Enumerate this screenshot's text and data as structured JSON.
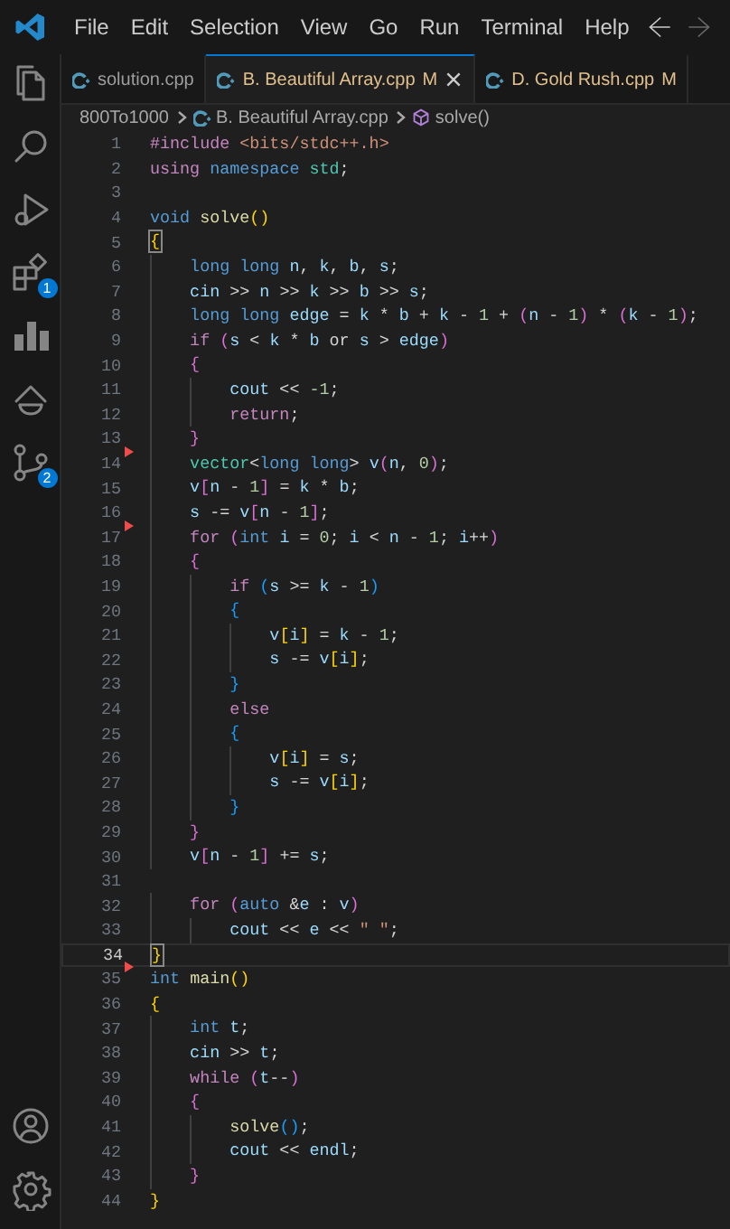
{
  "menu": [
    "File",
    "Edit",
    "Selection",
    "View",
    "Go",
    "Run",
    "Terminal",
    "Help"
  ],
  "activity_bar": [
    {
      "kind": "explorer"
    },
    {
      "kind": "search"
    },
    {
      "kind": "debug"
    },
    {
      "kind": "extensions",
      "badge": "1"
    },
    {
      "kind": "chart"
    },
    {
      "kind": "branch"
    },
    {
      "kind": "git",
      "badge": "2"
    }
  ],
  "activity_bar_bottom": [
    {
      "kind": "account"
    },
    {
      "kind": "settings"
    }
  ],
  "tabs": [
    {
      "label": "solution.cpp",
      "selected": false
    },
    {
      "label": "B. Beautiful Array.cpp",
      "status": "M",
      "selected": true
    },
    {
      "label": "D. Gold Rush.cpp",
      "status": "M",
      "selected": false
    }
  ],
  "breadcrumbs": [
    {
      "kind": "folder",
      "text": "800To1000"
    },
    {
      "kind": "file",
      "text": "B. Beautiful Array.cpp"
    },
    {
      "kind": "symbol",
      "text": "solve()"
    }
  ],
  "lines": [
    {
      "number": "1",
      "tokens": [
        {
          "kind": "control",
          "text": "#include "
        },
        {
          "kind": "string",
          "text": "<bits/stdc++.h>"
        }
      ]
    },
    {
      "number": "2",
      "tokens": [
        {
          "kind": "control",
          "text": "using "
        },
        {
          "kind": "keyword",
          "text": "namespace "
        },
        {
          "kind": "type",
          "text": "std"
        },
        {
          "kind": "operator",
          "text": ";"
        }
      ]
    },
    {
      "number": "3"
    },
    {
      "number": "4",
      "tokens": [
        {
          "kind": "keyword",
          "text": "void "
        },
        {
          "kind": "function",
          "text": "solve"
        },
        {
          "kind": "bracket1",
          "text": "()"
        }
      ]
    },
    {
      "number": "5",
      "bracket_match": true,
      "tokens": [
        {
          "kind": "bracket1",
          "text": "{"
        }
      ]
    },
    {
      "number": "6",
      "tokens": [
        {
          "kind": "keyword",
          "text": "    long long "
        },
        {
          "kind": "variable",
          "text": "n"
        },
        {
          "kind": "operator",
          "text": ", "
        },
        {
          "kind": "variable",
          "text": "k"
        },
        {
          "kind": "operator",
          "text": ", "
        },
        {
          "kind": "variable",
          "text": "b"
        },
        {
          "kind": "operator",
          "text": ", "
        },
        {
          "kind": "variable",
          "text": "s"
        },
        {
          "kind": "operator",
          "text": ";"
        }
      ]
    },
    {
      "number": "7",
      "tokens": [
        {
          "kind": "variable",
          "text": "    cin"
        },
        {
          "kind": "operator",
          "text": " >> "
        },
        {
          "kind": "variable",
          "text": "n"
        },
        {
          "kind": "operator",
          "text": " >> "
        },
        {
          "kind": "variable",
          "text": "k"
        },
        {
          "kind": "operator",
          "text": " >> "
        },
        {
          "kind": "variable",
          "text": "b"
        },
        {
          "kind": "operator",
          "text": " >> "
        },
        {
          "kind": "variable",
          "text": "s"
        },
        {
          "kind": "operator",
          "text": ";"
        }
      ]
    },
    {
      "number": "8",
      "tokens": [
        {
          "kind": "keyword",
          "text": "    long long "
        },
        {
          "kind": "variable",
          "text": "edge"
        },
        {
          "kind": "operator",
          "text": " = "
        },
        {
          "kind": "variable",
          "text": "k"
        },
        {
          "kind": "operator",
          "text": " * "
        },
        {
          "kind": "variable",
          "text": "b"
        },
        {
          "kind": "operator",
          "text": " + "
        },
        {
          "kind": "variable",
          "text": "k"
        },
        {
          "kind": "operator",
          "text": " - "
        },
        {
          "kind": "number",
          "text": "1"
        },
        {
          "kind": "operator",
          "text": " + "
        },
        {
          "kind": "bracket2",
          "text": "("
        },
        {
          "kind": "variable",
          "text": "n"
        },
        {
          "kind": "operator",
          "text": " - "
        },
        {
          "kind": "number",
          "text": "1"
        },
        {
          "kind": "bracket2",
          "text": ")"
        },
        {
          "kind": "operator",
          "text": " * "
        },
        {
          "kind": "bracket2",
          "text": "("
        },
        {
          "kind": "variable",
          "text": "k"
        },
        {
          "kind": "operator",
          "text": " - "
        },
        {
          "kind": "number",
          "text": "1"
        },
        {
          "kind": "bracket2",
          "text": ")"
        },
        {
          "kind": "operator",
          "text": ";"
        }
      ]
    },
    {
      "number": "9",
      "tokens": [
        {
          "kind": "control",
          "text": "    if "
        },
        {
          "kind": "bracket2",
          "text": "("
        },
        {
          "kind": "variable",
          "text": "s"
        },
        {
          "kind": "operator",
          "text": " < "
        },
        {
          "kind": "variable",
          "text": "k"
        },
        {
          "kind": "operator",
          "text": " * "
        },
        {
          "kind": "variable",
          "text": "b"
        },
        {
          "kind": "operator",
          "text": " or "
        },
        {
          "kind": "variable",
          "text": "s"
        },
        {
          "kind": "operator",
          "text": " > "
        },
        {
          "kind": "variable",
          "text": "edge"
        },
        {
          "kind": "bracket2",
          "text": ")"
        }
      ]
    },
    {
      "number": "10",
      "tokens": [
        {
          "kind": "bracket2",
          "text": "    {"
        }
      ]
    },
    {
      "number": "11",
      "tokens": [
        {
          "kind": "variable",
          "text": "        cout"
        },
        {
          "kind": "operator",
          "text": " << "
        },
        {
          "kind": "number",
          "text": "-1"
        },
        {
          "kind": "operator",
          "text": ";"
        }
      ]
    },
    {
      "number": "12",
      "tokens": [
        {
          "kind": "control",
          "text": "        return"
        },
        {
          "kind": "operator",
          "text": ";"
        }
      ]
    },
    {
      "number": "13",
      "tokens": [
        {
          "kind": "bracket2",
          "text": "    }"
        }
      ]
    },
    {
      "number": "14",
      "deleted": true,
      "tokens": [
        {
          "kind": "type",
          "text": "    vector"
        },
        {
          "kind": "operator",
          "text": "<"
        },
        {
          "kind": "keyword",
          "text": "long long"
        },
        {
          "kind": "operator",
          "text": "> "
        },
        {
          "kind": "variable",
          "text": "v"
        },
        {
          "kind": "bracket2",
          "text": "("
        },
        {
          "kind": "variable",
          "text": "n"
        },
        {
          "kind": "operator",
          "text": ", "
        },
        {
          "kind": "number",
          "text": "0"
        },
        {
          "kind": "bracket2",
          "text": ")"
        },
        {
          "kind": "operator",
          "text": ";"
        }
      ]
    },
    {
      "number": "15",
      "tokens": [
        {
          "kind": "variable",
          "text": "    v"
        },
        {
          "kind": "bracket2",
          "text": "["
        },
        {
          "kind": "variable",
          "text": "n"
        },
        {
          "kind": "operator",
          "text": " - "
        },
        {
          "kind": "number",
          "text": "1"
        },
        {
          "kind": "bracket2",
          "text": "]"
        },
        {
          "kind": "operator",
          "text": " = "
        },
        {
          "kind": "variable",
          "text": "k"
        },
        {
          "kind": "operator",
          "text": " * "
        },
        {
          "kind": "variable",
          "text": "b"
        },
        {
          "kind": "operator",
          "text": ";"
        }
      ]
    },
    {
      "number": "16",
      "tokens": [
        {
          "kind": "variable",
          "text": "    s"
        },
        {
          "kind": "operator",
          "text": " -= "
        },
        {
          "kind": "variable",
          "text": "v"
        },
        {
          "kind": "bracket2",
          "text": "["
        },
        {
          "kind": "variable",
          "text": "n"
        },
        {
          "kind": "operator",
          "text": " - "
        },
        {
          "kind": "number",
          "text": "1"
        },
        {
          "kind": "bracket2",
          "text": "]"
        },
        {
          "kind": "operator",
          "text": ";"
        }
      ]
    },
    {
      "number": "17",
      "deleted": true,
      "tokens": [
        {
          "kind": "control",
          "text": "    for "
        },
        {
          "kind": "bracket2",
          "text": "("
        },
        {
          "kind": "keyword",
          "text": "int "
        },
        {
          "kind": "variable",
          "text": "i"
        },
        {
          "kind": "operator",
          "text": " = "
        },
        {
          "kind": "number",
          "text": "0"
        },
        {
          "kind": "operator",
          "text": "; "
        },
        {
          "kind": "variable",
          "text": "i"
        },
        {
          "kind": "operator",
          "text": " < "
        },
        {
          "kind": "variable",
          "text": "n"
        },
        {
          "kind": "operator",
          "text": " - "
        },
        {
          "kind": "number",
          "text": "1"
        },
        {
          "kind": "operator",
          "text": "; "
        },
        {
          "kind": "variable",
          "text": "i"
        },
        {
          "kind": "operator",
          "text": "++"
        },
        {
          "kind": "bracket2",
          "text": ")"
        }
      ]
    },
    {
      "number": "18",
      "tokens": [
        {
          "kind": "bracket2",
          "text": "    {"
        }
      ]
    },
    {
      "number": "19",
      "tokens": [
        {
          "kind": "control",
          "text": "        if "
        },
        {
          "kind": "bracket3",
          "text": "("
        },
        {
          "kind": "variable",
          "text": "s"
        },
        {
          "kind": "operator",
          "text": " >= "
        },
        {
          "kind": "variable",
          "text": "k"
        },
        {
          "kind": "operator",
          "text": " - "
        },
        {
          "kind": "number",
          "text": "1"
        },
        {
          "kind": "bracket3",
          "text": ")"
        }
      ]
    },
    {
      "number": "20",
      "tokens": [
        {
          "kind": "bracket3",
          "text": "        {"
        }
      ]
    },
    {
      "number": "21",
      "tokens": [
        {
          "kind": "variable",
          "text": "            v"
        },
        {
          "kind": "bracket1",
          "text": "["
        },
        {
          "kind": "variable",
          "text": "i"
        },
        {
          "kind": "bracket1",
          "text": "]"
        },
        {
          "kind": "operator",
          "text": " = "
        },
        {
          "kind": "variable",
          "text": "k"
        },
        {
          "kind": "operator",
          "text": " - "
        },
        {
          "kind": "number",
          "text": "1"
        },
        {
          "kind": "operator",
          "text": ";"
        }
      ]
    },
    {
      "number": "22",
      "tokens": [
        {
          "kind": "variable",
          "text": "            s"
        },
        {
          "kind": "operator",
          "text": " -= "
        },
        {
          "kind": "variable",
          "text": "v"
        },
        {
          "kind": "bracket1",
          "text": "["
        },
        {
          "kind": "variable",
          "text": "i"
        },
        {
          "kind": "bracket1",
          "text": "]"
        },
        {
          "kind": "operator",
          "text": ";"
        }
      ]
    },
    {
      "number": "23",
      "tokens": [
        {
          "kind": "bracket3",
          "text": "        }"
        }
      ]
    },
    {
      "number": "24",
      "tokens": [
        {
          "kind": "control",
          "text": "        else"
        }
      ]
    },
    {
      "number": "25",
      "tokens": [
        {
          "kind": "bracket3",
          "text": "        {"
        }
      ]
    },
    {
      "number": "26",
      "tokens": [
        {
          "kind": "variable",
          "text": "            v"
        },
        {
          "kind": "bracket1",
          "text": "["
        },
        {
          "kind": "variable",
          "text": "i"
        },
        {
          "kind": "bracket1",
          "text": "]"
        },
        {
          "kind": "operator",
          "text": " = "
        },
        {
          "kind": "variable",
          "text": "s"
        },
        {
          "kind": "operator",
          "text": ";"
        }
      ]
    },
    {
      "number": "27",
      "tokens": [
        {
          "kind": "variable",
          "text": "            s"
        },
        {
          "kind": "operator",
          "text": " -= "
        },
        {
          "kind": "variable",
          "text": "v"
        },
        {
          "kind": "bracket1",
          "text": "["
        },
        {
          "kind": "variable",
          "text": "i"
        },
        {
          "kind": "bracket1",
          "text": "]"
        },
        {
          "kind": "operator",
          "text": ";"
        }
      ]
    },
    {
      "number": "28",
      "tokens": [
        {
          "kind": "bracket3",
          "text": "        }"
        }
      ]
    },
    {
      "number": "29",
      "tokens": [
        {
          "kind": "bracket2",
          "text": "    }"
        }
      ]
    },
    {
      "number": "30",
      "tokens": [
        {
          "kind": "variable",
          "text": "    v"
        },
        {
          "kind": "bracket2",
          "text": "["
        },
        {
          "kind": "variable",
          "text": "n"
        },
        {
          "kind": "operator",
          "text": " - "
        },
        {
          "kind": "number",
          "text": "1"
        },
        {
          "kind": "bracket2",
          "text": "]"
        },
        {
          "kind": "operator",
          "text": " += "
        },
        {
          "kind": "variable",
          "text": "s"
        },
        {
          "kind": "operator",
          "text": ";"
        }
      ]
    },
    {
      "number": "31"
    },
    {
      "number": "32",
      "tokens": [
        {
          "kind": "control",
          "text": "    for "
        },
        {
          "kind": "bracket2",
          "text": "("
        },
        {
          "kind": "keyword",
          "text": "auto "
        },
        {
          "kind": "operator",
          "text": "&"
        },
        {
          "kind": "variable",
          "text": "e"
        },
        {
          "kind": "operator",
          "text": " : "
        },
        {
          "kind": "variable",
          "text": "v"
        },
        {
          "kind": "bracket2",
          "text": ")"
        }
      ]
    },
    {
      "number": "33",
      "tokens": [
        {
          "kind": "variable",
          "text": "        cout"
        },
        {
          "kind": "operator",
          "text": " << "
        },
        {
          "kind": "variable",
          "text": "e"
        },
        {
          "kind": "operator",
          "text": " << "
        },
        {
          "kind": "string",
          "text": "\" \""
        },
        {
          "kind": "operator",
          "text": ";"
        }
      ]
    },
    {
      "number": "34",
      "current": true,
      "bracket_match": true,
      "tokens": [
        {
          "kind": "bracket1",
          "text": "}"
        }
      ]
    },
    {
      "number": "35",
      "deleted": true,
      "tokens": [
        {
          "kind": "keyword",
          "text": "int "
        },
        {
          "kind": "function",
          "text": "main"
        },
        {
          "kind": "bracket1",
          "text": "()"
        }
      ]
    },
    {
      "number": "36",
      "tokens": [
        {
          "kind": "bracket1",
          "text": "{"
        }
      ]
    },
    {
      "number": "37",
      "tokens": [
        {
          "kind": "keyword",
          "text": "    int "
        },
        {
          "kind": "variable",
          "text": "t"
        },
        {
          "kind": "operator",
          "text": ";"
        }
      ]
    },
    {
      "number": "38",
      "tokens": [
        {
          "kind": "variable",
          "text": "    cin"
        },
        {
          "kind": "operator",
          "text": " >> "
        },
        {
          "kind": "variable",
          "text": "t"
        },
        {
          "kind": "operator",
          "text": ";"
        }
      ]
    },
    {
      "number": "39",
      "tokens": [
        {
          "kind": "control",
          "text": "    while "
        },
        {
          "kind": "bracket2",
          "text": "("
        },
        {
          "kind": "variable",
          "text": "t"
        },
        {
          "kind": "operator",
          "text": "--"
        },
        {
          "kind": "bracket2",
          "text": ")"
        }
      ]
    },
    {
      "number": "40",
      "tokens": [
        {
          "kind": "bracket2",
          "text": "    {"
        }
      ]
    },
    {
      "number": "41",
      "tokens": [
        {
          "kind": "function",
          "text": "        solve"
        },
        {
          "kind": "bracket3",
          "text": "()"
        },
        {
          "kind": "operator",
          "text": ";"
        }
      ]
    },
    {
      "number": "42",
      "tokens": [
        {
          "kind": "variable",
          "text": "        cout"
        },
        {
          "kind": "operator",
          "text": " << "
        },
        {
          "kind": "variable",
          "text": "endl"
        },
        {
          "kind": "operator",
          "text": ";"
        }
      ]
    },
    {
      "number": "43",
      "tokens": [
        {
          "kind": "bracket2",
          "text": "    }"
        }
      ]
    },
    {
      "number": "44",
      "tokens": [
        {
          "kind": "bracket1",
          "text": "}"
        }
      ]
    }
  ]
}
